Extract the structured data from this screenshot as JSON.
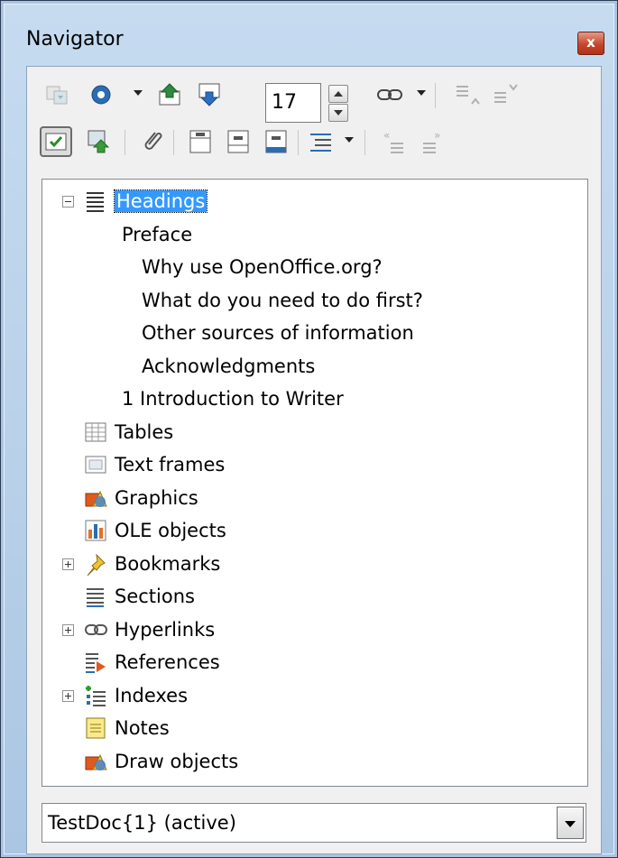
{
  "window": {
    "title": "Navigator",
    "close_glyph": "x"
  },
  "toolbar": {
    "row1": {
      "buttons": [
        "navigation-toggle-icon",
        "navigation-circle-icon",
        "previous-object-icon",
        "next-object-icon"
      ],
      "page_number": "17",
      "drag_mode": "hyperlink-icon",
      "promote_level": "promote-level-icon",
      "demote_level": "demote-level-icon"
    },
    "row2": {
      "buttons": [
        "list-box-on-off-icon",
        "content-view-icon",
        "reminder-icon",
        "header-icon",
        "footer-icon",
        "anchor-icon",
        "heading-levels-icon",
        "promote-chapter-icon",
        "demote-chapter-icon"
      ]
    }
  },
  "tree": {
    "headings_label": "Headings",
    "headings": [
      "Preface",
      "Why use OpenOffice.org?",
      "What do you need to do first?",
      "Other sources of information",
      "Acknowledgments",
      "1  Introduction to Writer"
    ],
    "categories": [
      {
        "label": "Tables",
        "icon": "tables-icon",
        "expandable": false
      },
      {
        "label": "Text frames",
        "icon": "text-frames-icon",
        "expandable": false
      },
      {
        "label": "Graphics",
        "icon": "graphics-icon",
        "expandable": false
      },
      {
        "label": "OLE objects",
        "icon": "ole-objects-icon",
        "expandable": false
      },
      {
        "label": "Bookmarks",
        "icon": "bookmarks-icon",
        "expandable": true
      },
      {
        "label": "Sections",
        "icon": "sections-icon",
        "expandable": false
      },
      {
        "label": "Hyperlinks",
        "icon": "hyperlinks-icon",
        "expandable": true
      },
      {
        "label": "References",
        "icon": "references-icon",
        "expandable": false
      },
      {
        "label": "Indexes",
        "icon": "indexes-icon",
        "expandable": true
      },
      {
        "label": "Notes",
        "icon": "notes-icon",
        "expandable": false
      },
      {
        "label": "Draw objects",
        "icon": "draw-objects-icon",
        "expandable": false
      }
    ]
  },
  "document_select": {
    "value": "TestDoc{1} (active)"
  },
  "colors": {
    "selection": "#3399ff",
    "frame": "#b7cfe8"
  }
}
